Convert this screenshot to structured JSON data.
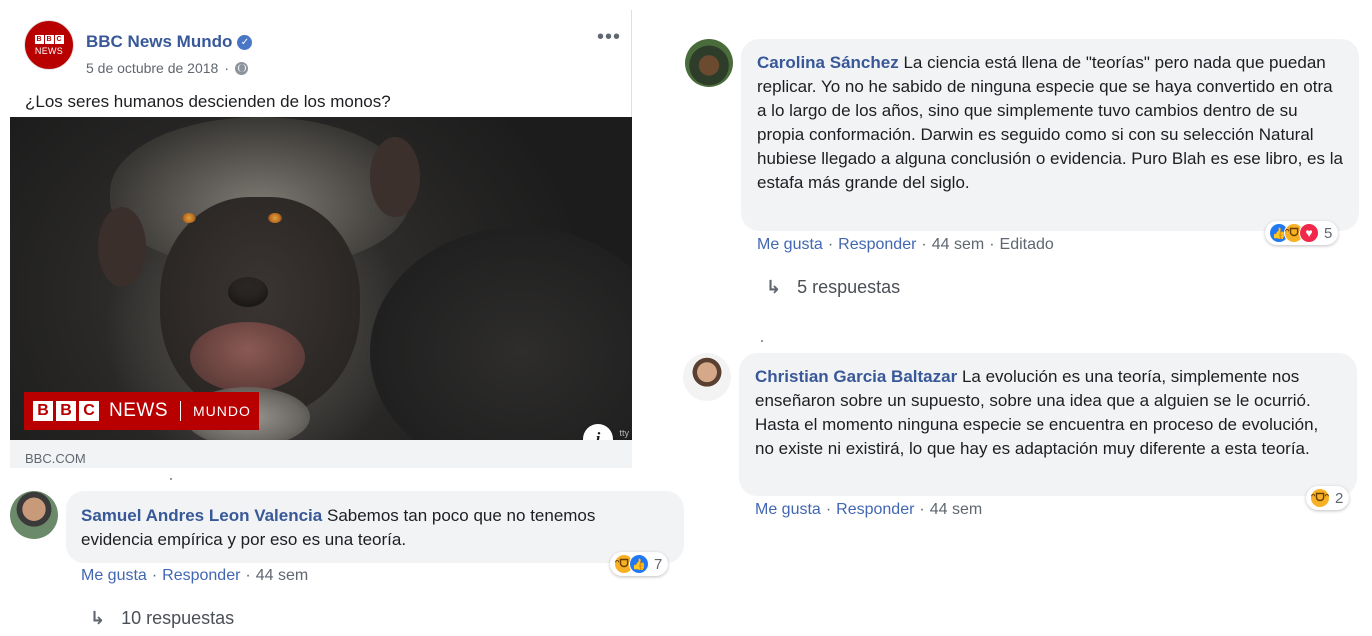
{
  "post": {
    "page_name": "BBC News Mundo",
    "date": "5 de octubre de 2018",
    "text": "¿Los seres humanos descienden de los monos?",
    "avatar_letters": [
      "B",
      "B",
      "C"
    ],
    "avatar_sub": "NEWS",
    "banner_letters": [
      "B",
      "B",
      "C"
    ],
    "banner_news": "NEWS",
    "banner_mundo": "MUNDO",
    "image_credit": "tty",
    "info_label": "i",
    "link_domain": "BBC.COM",
    "more_label": "•••"
  },
  "comments": [
    {
      "author": "Samuel Andres Leon Valencia",
      "text": "Sabemos tan poco que no tenemos evidencia empírica y por eso es una teoría.",
      "like": "Me gusta",
      "reply": "Responder",
      "time": "44 sem",
      "reactions": [
        "haha",
        "like"
      ],
      "reaction_count": "7",
      "replies": "10 respuestas"
    },
    {
      "author": "Carolina Sánchez",
      "text": "La ciencia está llena de \"teorías\" pero nada que puedan replicar. Yo no he sabido de ninguna especie que se haya convertido en otra a lo largo de los años, sino que simplemente tuvo cambios dentro de su propia conformación. Darwin es seguido como si con su selección Natural hubiese llegado a alguna conclusión o evidencia. Puro Blah es ese libro, es la estafa más grande del siglo.",
      "like": "Me gusta",
      "reply": "Responder",
      "time": "44 sem",
      "edited": "Editado",
      "reactions": [
        "like",
        "haha",
        "love"
      ],
      "reaction_count": "5",
      "replies": "5 respuestas"
    },
    {
      "author": "Christian Garcia Baltazar",
      "text": "La evolución es una teoría, simplemente nos enseñaron sobre un supuesto, sobre una idea que a alguien se le ocurrió. Hasta el momento ninguna especie se encuentra en proceso de evolución, no existe ni existirá, lo que hay es adaptación muy diferente a esta teoría.",
      "like": "Me gusta",
      "reply": "Responder",
      "time": "44 sem",
      "reactions": [
        "haha"
      ],
      "reaction_count": "2"
    }
  ],
  "ui": {
    "separator": "·",
    "verified_mark": "✓",
    "reply_arrow": "↳"
  },
  "colors": {
    "link_blue": "#385898",
    "action_blue": "#4267b2",
    "bubble_gray": "#f2f3f5",
    "bbc_red": "#b80000"
  }
}
